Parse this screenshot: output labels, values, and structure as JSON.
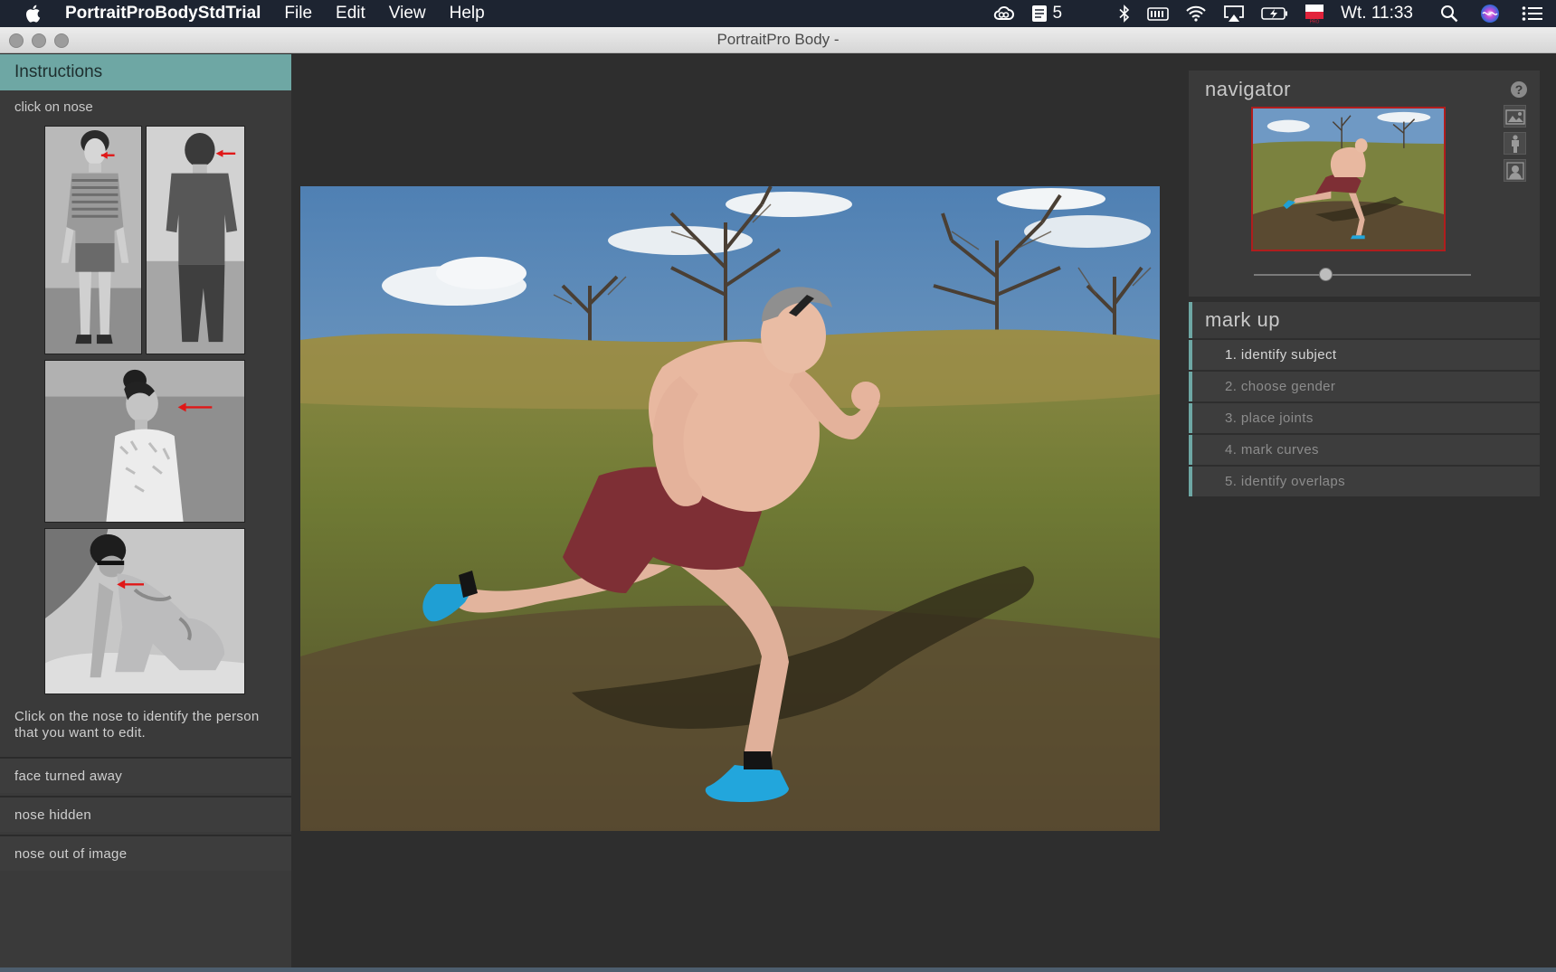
{
  "menubar": {
    "app_name": "PortraitProBodyStdTrial",
    "menus": [
      "File",
      "Edit",
      "View",
      "Help"
    ],
    "badge_count": "5",
    "clock": "Wt. 11:33"
  },
  "window": {
    "title": "PortraitPro Body -"
  },
  "instructions": {
    "header": "Instructions",
    "subheader": "click on nose",
    "description": "Click on the nose to identify the person that you want to edit.",
    "options": [
      "face turned away",
      "nose hidden",
      "nose out of image"
    ]
  },
  "navigator": {
    "title": "navigator",
    "help_symbol": "?",
    "zoom_level": 0.33
  },
  "markup": {
    "title": "mark up",
    "steps": [
      {
        "label": "1. identify subject",
        "active": true
      },
      {
        "label": "2. choose gender",
        "active": false
      },
      {
        "label": "3. place joints",
        "active": false
      },
      {
        "label": "4. mark curves",
        "active": false
      },
      {
        "label": "5. identify overlaps",
        "active": false
      }
    ]
  },
  "colors": {
    "accent_teal": "#6ea7a4",
    "menubar_bg": "#1d2431",
    "marker_red": "#e01818"
  },
  "icons": [
    "apple-icon",
    "creative-cloud-icon",
    "tasks-icon",
    "bluetooth-icon",
    "battery-monitor-icon",
    "wifi-icon",
    "airplay-icon",
    "battery-icon",
    "flag-icon",
    "search-icon",
    "siri-icon",
    "notification-center-icon",
    "scene-icon",
    "body-icon",
    "portrait-icon",
    "help-icon"
  ]
}
